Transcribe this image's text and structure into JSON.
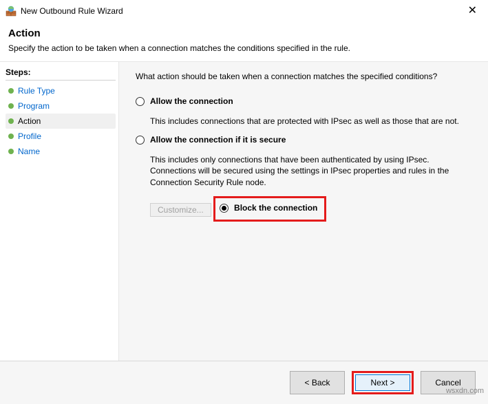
{
  "window": {
    "title": "New Outbound Rule Wizard"
  },
  "header": {
    "title": "Action",
    "subtitle": "Specify the action to be taken when a connection matches the conditions specified in the rule."
  },
  "sidebar": {
    "steps_label": "Steps:",
    "items": [
      {
        "label": "Rule Type",
        "current": false
      },
      {
        "label": "Program",
        "current": false
      },
      {
        "label": "Action",
        "current": true
      },
      {
        "label": "Profile",
        "current": false
      },
      {
        "label": "Name",
        "current": false
      }
    ]
  },
  "content": {
    "question": "What action should be taken when a connection matches the specified conditions?",
    "options": {
      "allow": {
        "label": "Allow the connection",
        "desc": "This includes connections that are protected with IPsec as well as those that are not."
      },
      "allow_secure": {
        "label": "Allow the connection if it is secure",
        "desc": "This includes only connections that have been authenticated by using IPsec. Connections will be secured using the settings in IPsec properties and rules in the Connection Security Rule node.",
        "customize_label": "Customize..."
      },
      "block": {
        "label": "Block the connection"
      }
    }
  },
  "footer": {
    "back": "< Back",
    "next": "Next >",
    "cancel": "Cancel"
  },
  "watermark": "wsxdn.com"
}
